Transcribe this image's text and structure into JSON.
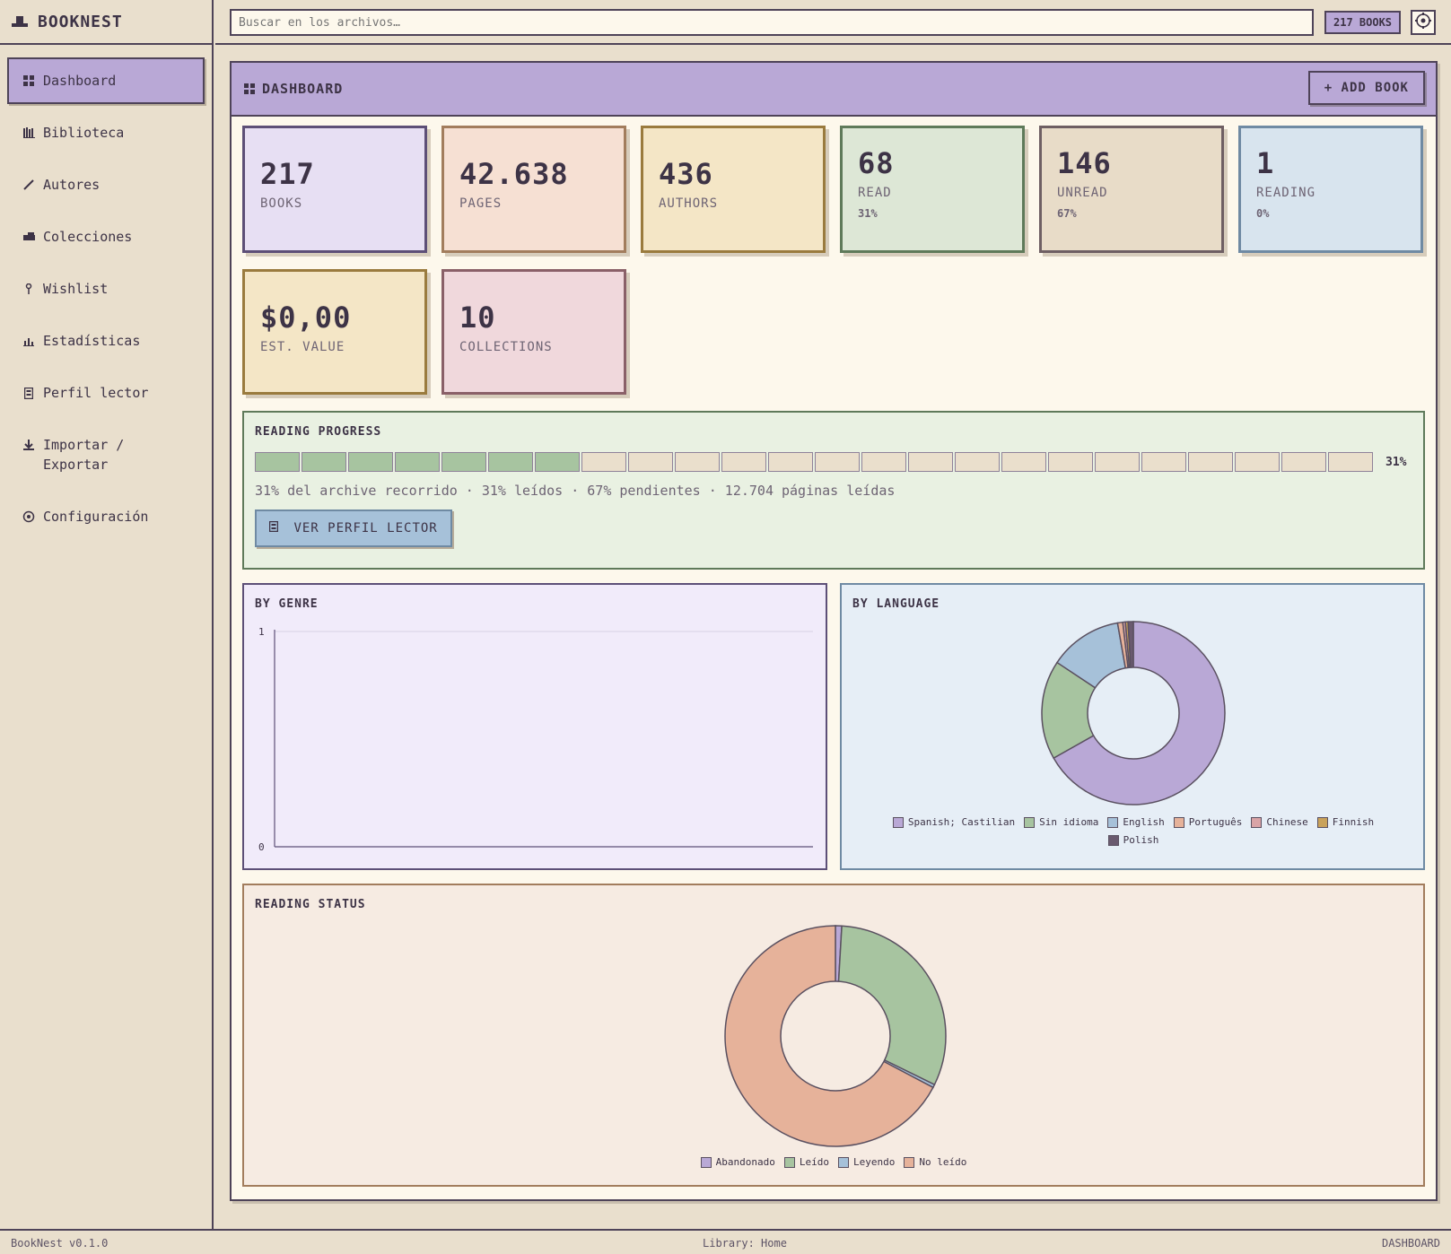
{
  "brand": {
    "name": "BOOKNEST"
  },
  "sidebar": {
    "items": [
      {
        "label": "Dashboard",
        "icon": "grid-icon"
      },
      {
        "label": "Biblioteca",
        "icon": "books-icon"
      },
      {
        "label": "Autores",
        "icon": "pen-icon"
      },
      {
        "label": "Colecciones",
        "icon": "stack-icon"
      },
      {
        "label": "Wishlist",
        "icon": "pin-icon"
      },
      {
        "label": "Estadísticas",
        "icon": "chart-icon"
      },
      {
        "label": "Perfil lector",
        "icon": "book-icon"
      },
      {
        "label": "Importar /\nExportar",
        "icon": "download-icon"
      },
      {
        "label": "Configuración",
        "icon": "gear-icon"
      }
    ]
  },
  "topbar": {
    "search_placeholder": "Buscar en los archivos…",
    "books_badge": "217 BOOKS"
  },
  "main": {
    "title": "DASHBOARD",
    "add_button": "+ ADD BOOK"
  },
  "stats": [
    {
      "value": "217",
      "label": "BOOKS",
      "sub": ""
    },
    {
      "value": "42.638",
      "label": "PAGES",
      "sub": ""
    },
    {
      "value": "436",
      "label": "AUTHORS",
      "sub": ""
    },
    {
      "value": "68",
      "label": "READ",
      "sub": "31%"
    },
    {
      "value": "146",
      "label": "UNREAD",
      "sub": "67%"
    },
    {
      "value": "1",
      "label": "READING",
      "sub": "0%"
    },
    {
      "value": "$0,00",
      "label": "EST. VALUE",
      "sub": ""
    },
    {
      "value": "10",
      "label": "COLLECTIONS",
      "sub": ""
    }
  ],
  "reading_progress": {
    "title": "READING PROGRESS",
    "percent": 0.31,
    "percent_label": "31%",
    "text": "31% del archive recorrido · 31% leídos · 67% pendientes · 12.704 páginas leídas",
    "button": "VER PERFIL LECTOR"
  },
  "colors": {
    "purple": "#b9a8d6",
    "green": "#a7c4a0",
    "blue": "#a6c1d9",
    "peach": "#e6b29a",
    "rose": "#d9a3a6",
    "ochre": "#c9a25a",
    "dark": "#6a5a6f"
  },
  "chart_data": [
    {
      "type": "bar",
      "title": "BY GENRE",
      "categories": [],
      "values": [],
      "ylim": [
        0,
        1
      ],
      "yticks": [
        "1",
        "0"
      ]
    },
    {
      "type": "pie",
      "title": "BY LANGUAGE",
      "labels": [
        "Spanish; Castilian",
        "Sin idioma",
        "English",
        "Português",
        "Chinese",
        "Finnish",
        "Polish"
      ],
      "values": [
        145,
        38,
        28,
        2,
        1,
        1,
        2
      ]
    },
    {
      "type": "pie",
      "title": "READING STATUS",
      "labels": [
        "Abandonado",
        "Leído",
        "Leyendo",
        "No leído"
      ],
      "values": [
        2,
        68,
        1,
        146
      ]
    }
  ],
  "footer": {
    "version": "BookNest v0.1.0",
    "library": "Library: Home",
    "view": "DASHBOARD"
  }
}
